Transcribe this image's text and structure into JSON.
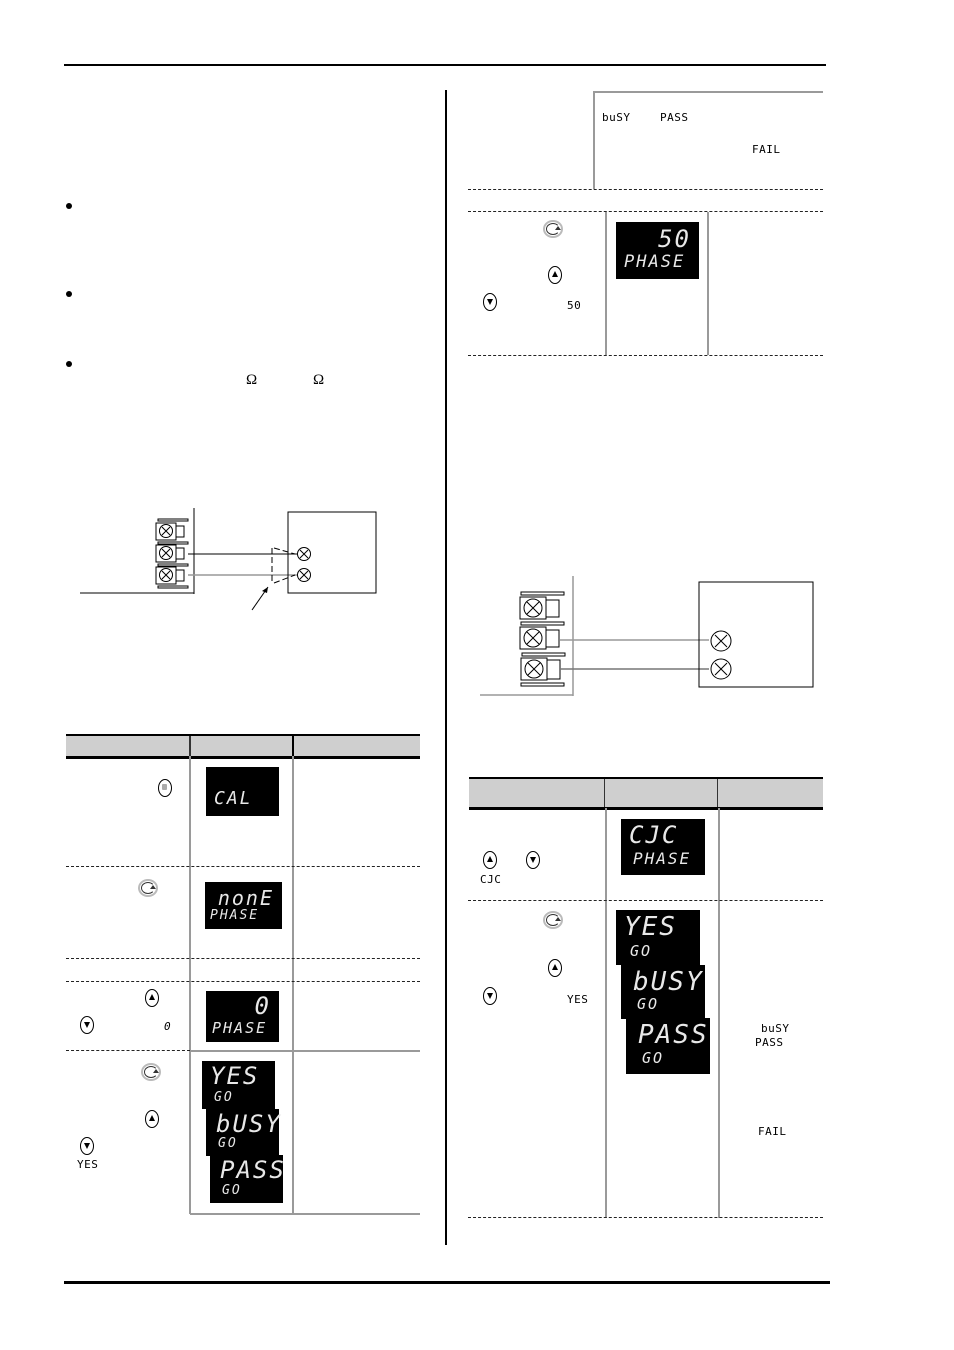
{
  "page": {
    "omega_symbol": "Ω"
  },
  "left_table": {
    "rows": [
      {
        "display_top": "",
        "display_bottom": "CAL",
        "button": "page-icon"
      },
      {
        "display_top": "nonE",
        "display_bottom": "PHASE",
        "button": "scroll-icon"
      },
      {
        "display_top": "0",
        "display_bottom": "PHASE",
        "inline_value": "0",
        "buttons": [
          "up-arrow-icon",
          "down-arrow-icon"
        ]
      },
      {
        "displays": [
          {
            "top": "YES",
            "bottom": "GO"
          },
          {
            "top": "bUSY",
            "bottom": "GO"
          },
          {
            "top": "PASS",
            "bottom": "GO"
          }
        ],
        "inline_value": "YES",
        "buttons": [
          "scroll-icon",
          "up-arrow-icon",
          "down-arrow-icon"
        ]
      }
    ]
  },
  "right_top_panel": {
    "status_busy": "buSY",
    "status_pass": "PASS",
    "status_fail": "FAIL"
  },
  "right_table_top": {
    "display_top": "50",
    "display_bottom": "PHASE",
    "inline_value": "50"
  },
  "right_table": {
    "rows": [
      {
        "display_top": "CJC",
        "display_bottom": "PHASE",
        "inline_value": "CJC"
      },
      {
        "displays": [
          {
            "top": "YES",
            "bottom": "GO"
          },
          {
            "top": "bUSY",
            "bottom": "GO"
          },
          {
            "top": "PASS",
            "bottom": "GO"
          }
        ],
        "inline_value": "YES",
        "status_busy": "buSY",
        "status_pass": "PASS",
        "status_fail": "FAIL"
      }
    ]
  }
}
